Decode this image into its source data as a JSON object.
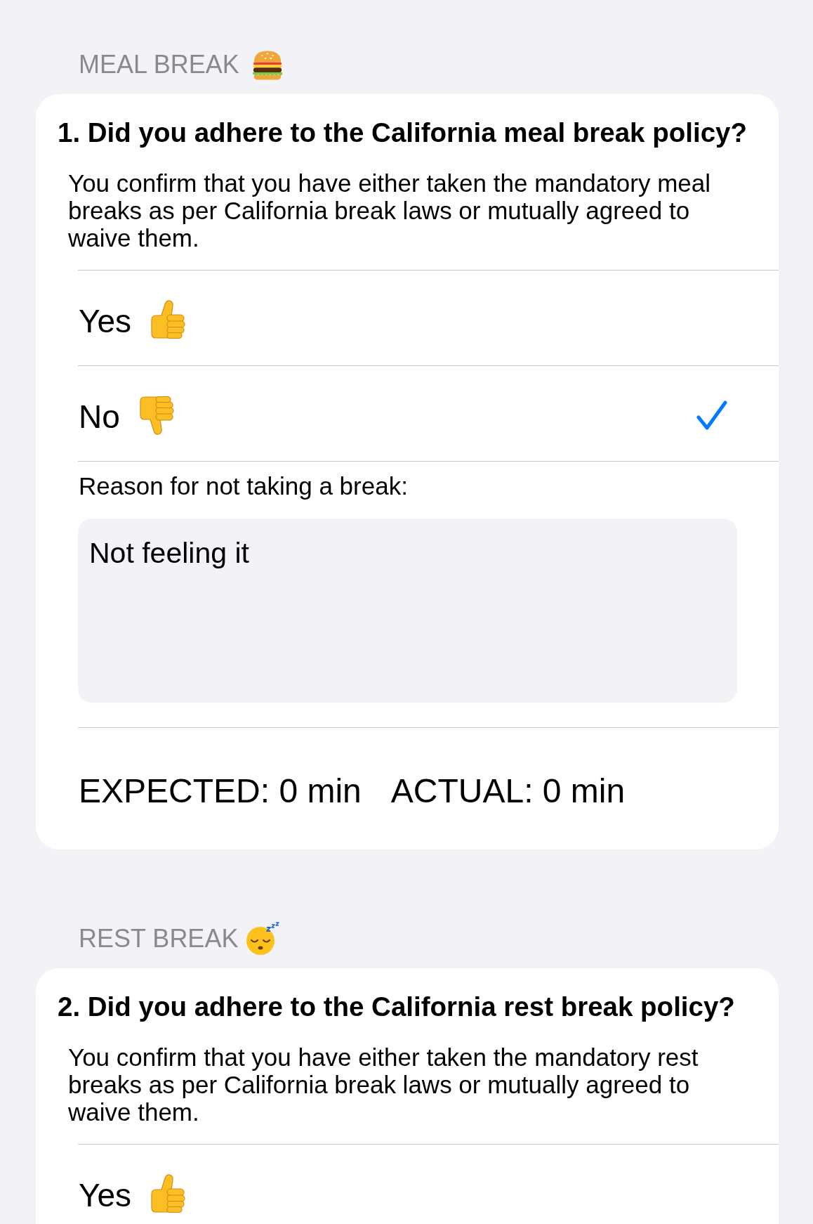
{
  "sections": [
    {
      "header": "MEAL BREAK",
      "question": "1. Did you adhere to the California meal break policy?",
      "description": "You confirm that you have either taken the mandatory meal breaks as per California break laws or mutually agreed to waive them.",
      "options": [
        {
          "label": "Yes",
          "selected": false
        },
        {
          "label": "No",
          "selected": true
        }
      ],
      "reason": {
        "label": "Reason for not taking a break:",
        "value": "Not feeling it"
      },
      "totals": [
        "EXPECTED: 0 min",
        "ACTUAL: 0 min"
      ]
    },
    {
      "header": "REST BREAK",
      "question": "2. Did you adhere to the California rest break policy?",
      "description": "You confirm that you have either taken the mandatory rest breaks as per California break laws or mutually agreed to waive them.",
      "options": [
        {
          "label": "Yes",
          "selected": false
        }
      ]
    }
  ]
}
